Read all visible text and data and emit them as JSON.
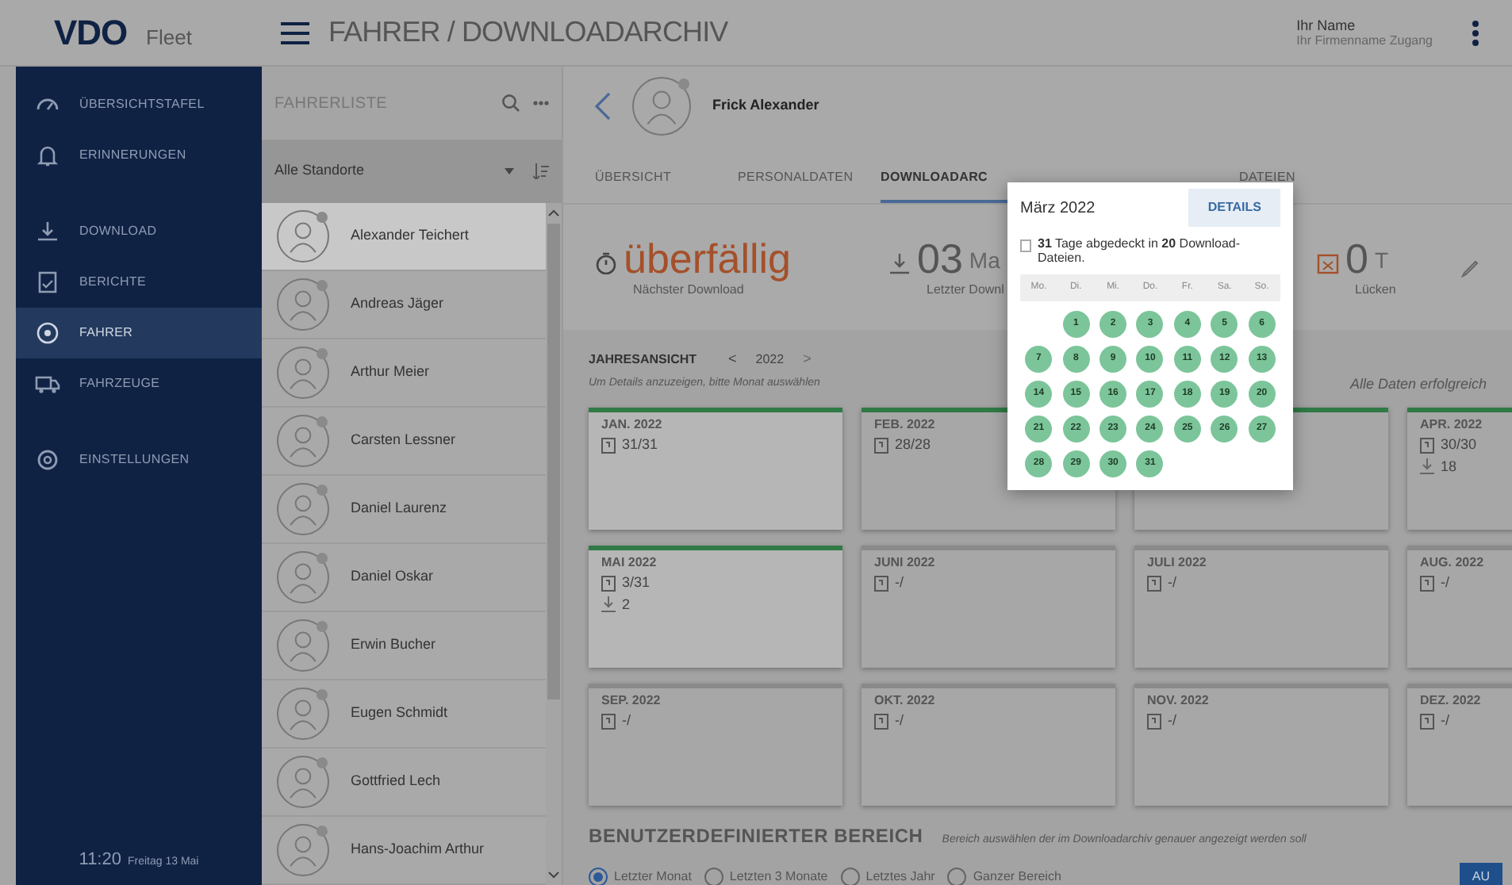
{
  "topbar": {
    "logo": "VDO",
    "logo_suffix": "Fleet",
    "title": "FAHRER / DOWNLOADARCHIV",
    "user_name": "Ihr Name",
    "user_company": "Ihr Firmenname Zugang"
  },
  "nav": {
    "items": [
      {
        "label": "ÜBERSICHTSTAFEL",
        "kind": "gauge",
        "selected": false
      },
      {
        "label": "ERINNERUNGEN",
        "kind": "bell",
        "selected": false
      },
      {
        "label": "DOWNLOAD",
        "kind": "download",
        "selected": false
      },
      {
        "label": "BERICHTE",
        "kind": "report",
        "selected": false
      },
      {
        "label": "FAHRER",
        "kind": "driver",
        "selected": true
      },
      {
        "label": "FAHRZEUGE",
        "kind": "truck",
        "selected": false
      },
      {
        "label": "EINSTELLUNGEN",
        "kind": "gear",
        "selected": false
      }
    ],
    "time": "11:20",
    "date": "Freitag 13 Mai"
  },
  "driver_list": {
    "title": "FAHRERLISTE",
    "filter": "Alle Standorte",
    "drivers": [
      {
        "name": "Alexander Teichert",
        "selected": true
      },
      {
        "name": "Andreas Jäger",
        "selected": false
      },
      {
        "name": "Arthur Meier",
        "selected": false
      },
      {
        "name": "Carsten Lessner",
        "selected": false
      },
      {
        "name": "Daniel Laurenz",
        "selected": false
      },
      {
        "name": "Daniel Oskar",
        "selected": false
      },
      {
        "name": "Erwin Bucher",
        "selected": false
      },
      {
        "name": "Eugen Schmidt",
        "selected": false
      },
      {
        "name": "Gottfried Lech",
        "selected": false
      },
      {
        "name": "Hans-Joachim Arthur",
        "selected": false
      }
    ]
  },
  "driver": {
    "name": "Frick Alexander"
  },
  "tabs": [
    {
      "label": "ÜBERSICHT",
      "selected": false
    },
    {
      "label": "PERSONALDATEN",
      "selected": false
    },
    {
      "label": "DOWNLOADARC",
      "selected": true
    },
    {
      "label": "DATEIEN",
      "selected": false
    }
  ],
  "stats": [
    {
      "kind": "status",
      "value": "überfällig",
      "label": "Nächster Download"
    },
    {
      "kind": "download",
      "value": "03",
      "unit": "Ma",
      "label": "Letzter Downl"
    },
    {
      "kind": "gaps",
      "value": "0",
      "unit": "T",
      "label": "Lücken"
    }
  ],
  "year_view": {
    "title": "JAHRESANSICHT",
    "prev": "<",
    "year": "2022",
    "next": ">",
    "hint": "Um Details anzuzeigen, bitte Monat auswählen",
    "status": "Alle Daten erfolgreich",
    "months": [
      {
        "label": "JAN. 2022",
        "files": "31/31",
        "has_data": true,
        "highlighted": true
      },
      {
        "label": "FEB. 2022",
        "files": "28/28",
        "has_data": true,
        "highlighted": false
      },
      {
        "has_data": true,
        "highlighted": false
      },
      {
        "label": "APR. 2022",
        "files": "30/30",
        "downloads": "18",
        "has_data": true,
        "highlighted": false
      },
      {
        "label": "MAI 2022",
        "files": "3/31",
        "downloads": "2",
        "has_data": true,
        "highlighted": true
      },
      {
        "label": "JUNI 2022",
        "files": "-/",
        "has_data": false,
        "highlighted": false
      },
      {
        "label": "JULI 2022",
        "files": "-/",
        "has_data": false,
        "highlighted": false
      },
      {
        "label": "AUG. 2022",
        "files": "-/",
        "has_data": false,
        "highlighted": false
      },
      {
        "label": "SEP. 2022",
        "files": "-/",
        "has_data": false,
        "highlighted": false
      },
      {
        "label": "OKT. 2022",
        "files": "-/",
        "has_data": false,
        "highlighted": false
      },
      {
        "label": "NOV. 2022",
        "files": "-/",
        "has_data": false,
        "highlighted": false
      },
      {
        "label": "DEZ. 2022",
        "files": "-/",
        "has_data": false,
        "highlighted": false
      }
    ]
  },
  "custom_range": {
    "title": "BENUTZERDEFINIERTER BEREICH",
    "hint": "Bereich auswählen der im Downloadarchiv genauer angezeigt werden soll",
    "options": [
      {
        "label": "Letzter Monat",
        "selected": true
      },
      {
        "label": "Letzten 3 Monate",
        "selected": false
      },
      {
        "label": "Letztes Jahr",
        "selected": false
      },
      {
        "label": "Ganzer Bereich",
        "selected": false
      }
    ],
    "button": "AU"
  },
  "popup": {
    "title": "März 2022",
    "button": "DETAILS",
    "summary": "**31** Tage abgedeckt in **20** Download-Dateien.",
    "weekdays": [
      "Mo.",
      "Di.",
      "Mi.",
      "Do.",
      "Fr.",
      "Sa.",
      "So."
    ],
    "days": [
      {
        "label": "1",
        "covered": true
      },
      {
        "label": "2",
        "covered": true
      },
      {
        "label": "3",
        "covered": true
      },
      {
        "label": "4",
        "covered": true
      },
      {
        "label": "5",
        "covered": true
      },
      {
        "label": "6",
        "covered": true
      },
      {
        "label": "7",
        "covered": true
      },
      {
        "label": "8",
        "covered": true
      },
      {
        "label": "9",
        "covered": true
      },
      {
        "label": "10",
        "covered": true
      },
      {
        "label": "11",
        "covered": true
      },
      {
        "label": "12",
        "covered": true
      },
      {
        "label": "13",
        "covered": true
      },
      {
        "label": "14",
        "covered": true
      },
      {
        "label": "15",
        "covered": true
      },
      {
        "label": "16",
        "covered": true
      },
      {
        "label": "17",
        "covered": true
      },
      {
        "label": "18",
        "covered": true
      },
      {
        "label": "19",
        "covered": true
      },
      {
        "label": "20",
        "covered": true
      },
      {
        "label": "21",
        "covered": true
      },
      {
        "label": "22",
        "covered": true
      },
      {
        "label": "23",
        "covered": true
      },
      {
        "label": "24",
        "covered": true
      },
      {
        "label": "25",
        "covered": true
      },
      {
        "label": "26",
        "covered": true
      },
      {
        "label": "27",
        "covered": true
      },
      {
        "label": "28",
        "covered": true
      },
      {
        "label": "29",
        "covered": true
      },
      {
        "label": "30",
        "covered": true
      },
      {
        "label": "31",
        "covered": true
      }
    ]
  }
}
